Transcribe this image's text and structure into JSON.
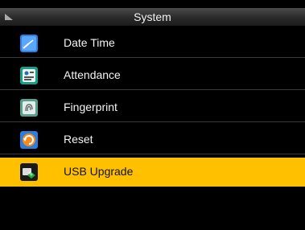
{
  "header": {
    "title": "System"
  },
  "menu": {
    "items": [
      {
        "label": "Date Time",
        "icon": "clock-icon"
      },
      {
        "label": "Attendance",
        "icon": "attendance-icon"
      },
      {
        "label": "Fingerprint",
        "icon": "fingerprint-icon"
      },
      {
        "label": "Reset",
        "icon": "reset-icon"
      },
      {
        "label": "USB Upgrade",
        "icon": "usb-icon",
        "selected": true
      }
    ]
  },
  "colors": {
    "selected_bg": "#ffc000",
    "background": "#000000"
  }
}
